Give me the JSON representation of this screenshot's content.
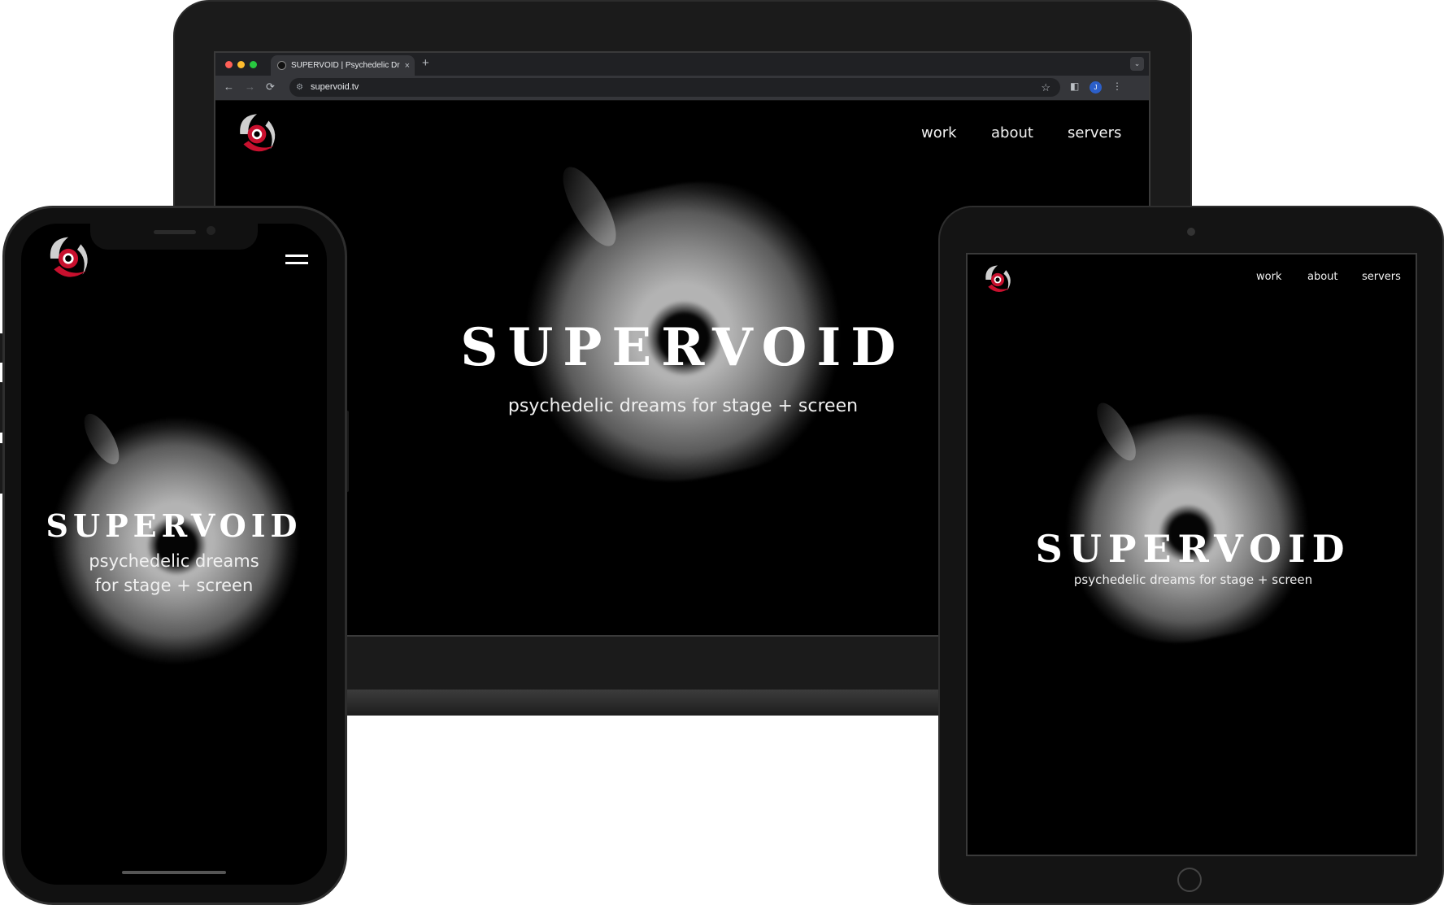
{
  "browser": {
    "tab_title": "SUPERVOID | Psychedelic Dreams",
    "tab_close": "×",
    "new_tab": "+",
    "tabs_menu": "⌄",
    "url": "supervoid.tv",
    "back": "←",
    "forward": "→",
    "reload": "⟳",
    "star": "☆",
    "profile_initial": "J",
    "more": "⋮"
  },
  "site": {
    "brand": "SUPERVOID",
    "tagline": "psychedelic dreams for stage + screen",
    "tagline_line1": "psychedelic dreams",
    "tagline_line2": "for stage + screen",
    "nav": {
      "work": "work",
      "about": "about",
      "servers": "servers"
    },
    "menu_icon": "hamburger-menu-icon"
  },
  "colors": {
    "background": "#000000",
    "logo_red": "#c8102e",
    "device_frame": "#1b1b1b"
  }
}
